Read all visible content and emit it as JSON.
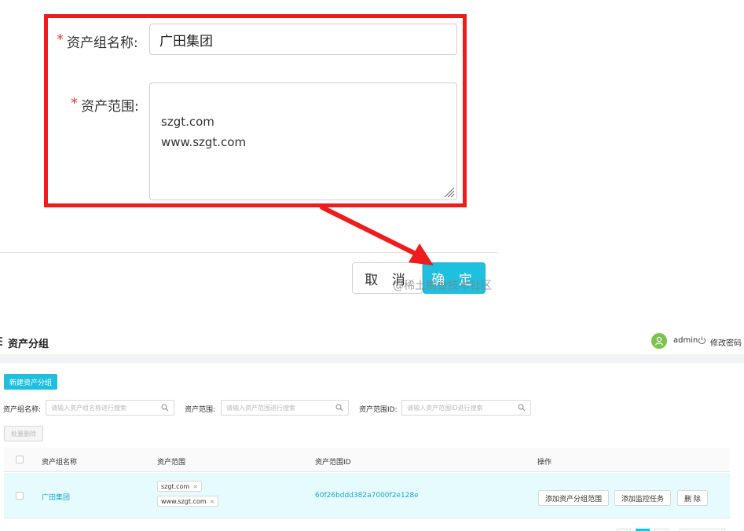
{
  "dialog": {
    "group_name_label": "资产组名称:",
    "group_name_value": "广田集团",
    "scope_label": "资产范围:",
    "scope_value": "szgt.com\nwww.szgt.com",
    "cancel_label": "取 消",
    "ok_label": "确 定",
    "watermark": "@稀土掘金技术社区",
    "highlight_color": "#ee1c1c",
    "accent": "#1ec0e0"
  },
  "app": {
    "title": "资产分组",
    "user": "admin",
    "change_password": "修改密码",
    "new_group_button": "新建资产分组",
    "filters": [
      {
        "label": "资产组名称:",
        "placeholder": "请输入资产组名称进行搜索"
      },
      {
        "label": "资产范围:",
        "placeholder": "请输入资产范围进行搜索"
      },
      {
        "label": "资产范围ID:",
        "placeholder": "请输入资产范围ID进行搜索"
      }
    ],
    "batch_delete": "批量删除",
    "table": {
      "columns": [
        "资产组名称",
        "资产范围",
        "资产范围ID",
        "操作"
      ],
      "rows": [
        {
          "name": "广田集团",
          "scopes": [
            "szgt.com",
            "www.szgt.com"
          ],
          "scope_id": "60f26bddd382a7000f2e128e",
          "actions": [
            "添加资产分组范围",
            "添加监控任务",
            "删 除"
          ]
        }
      ]
    }
  },
  "icons": {
    "search": "search-icon",
    "user": "user-icon",
    "logout": "power-icon",
    "close": "close-icon"
  }
}
